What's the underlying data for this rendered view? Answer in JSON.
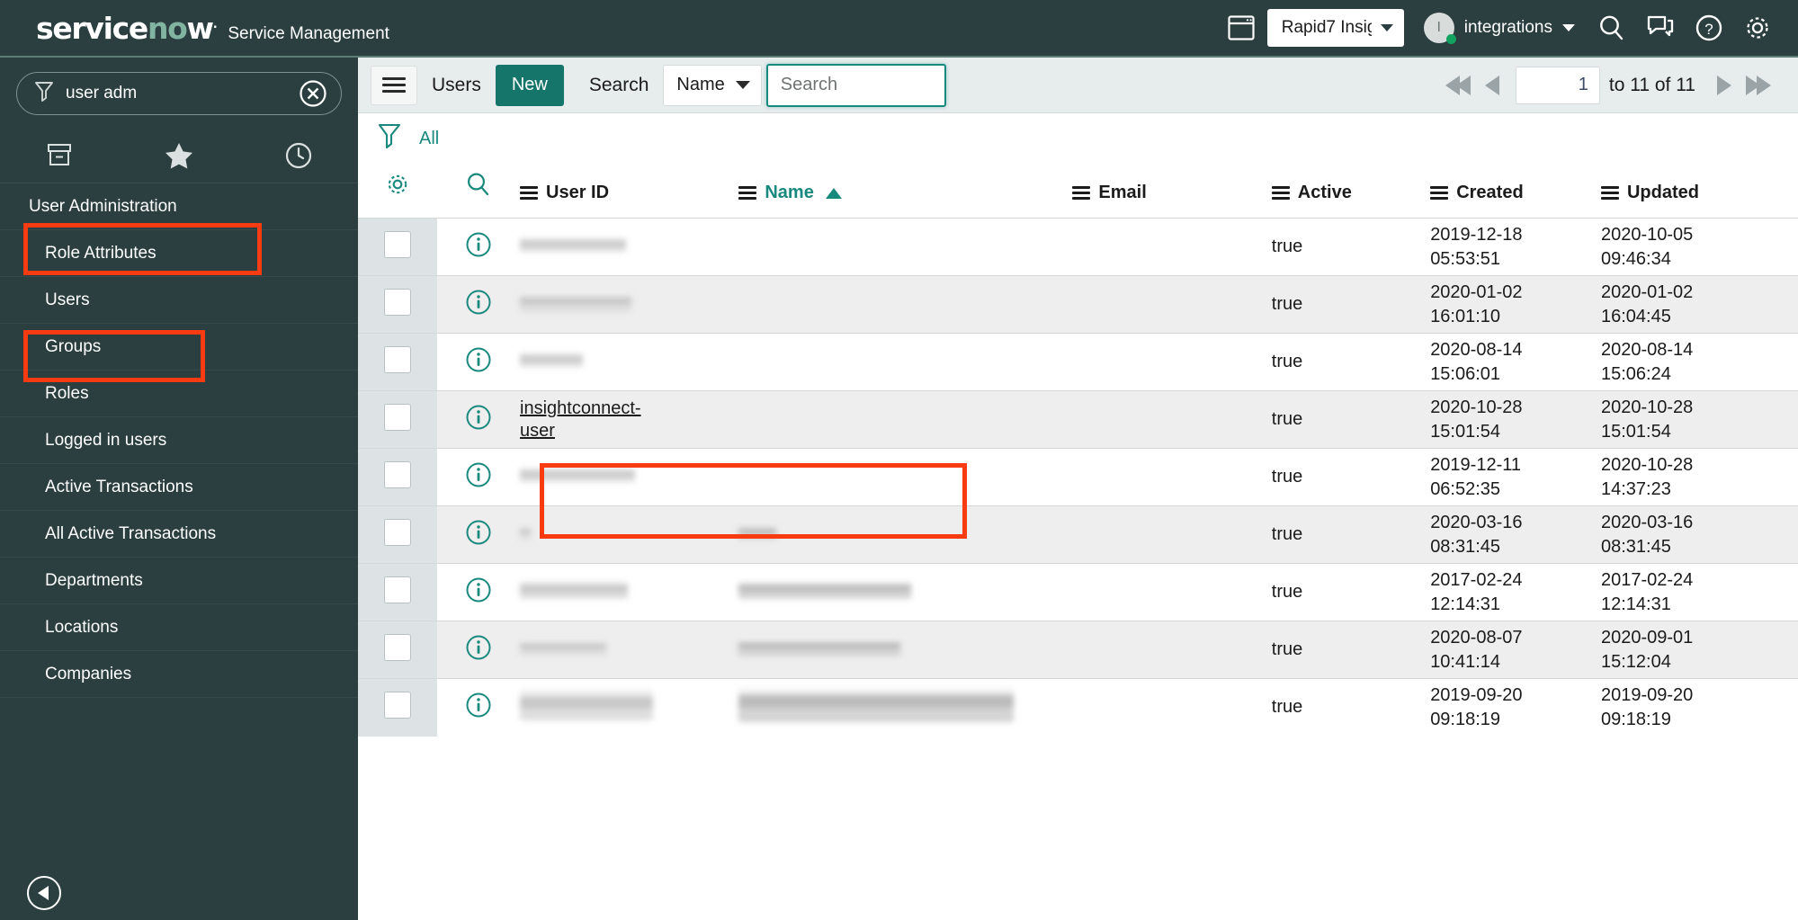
{
  "banner": {
    "logo_text": "servicenow",
    "logo_tm": ".",
    "product": "Service Management",
    "window_icon": "window-icon",
    "domain_picker": {
      "value": "Rapid7 Insig",
      "caret": "chevron-down-icon"
    },
    "user": {
      "initial": "I",
      "name": "integrations",
      "status": "online"
    },
    "icons": [
      "search-icon",
      "conversation-icon",
      "help-icon",
      "gear-icon"
    ]
  },
  "sidebar": {
    "filter": {
      "value": "user adm",
      "icon": "funnel-icon",
      "clear_icon": "clear-circle-icon"
    },
    "tabs": [
      {
        "name": "all-applications",
        "icon": "archive-box-icon"
      },
      {
        "name": "favorites",
        "icon": "star-icon"
      },
      {
        "name": "history",
        "icon": "clock-icon"
      }
    ],
    "items": [
      {
        "label": "User Administration",
        "type": "application",
        "highlighted": true
      },
      {
        "label": "Role Attributes",
        "type": "module",
        "highlighted": false
      },
      {
        "label": "Users",
        "type": "module",
        "highlighted": true
      },
      {
        "label": "Groups",
        "type": "module",
        "highlighted": false
      },
      {
        "label": "Roles",
        "type": "module",
        "highlighted": false
      },
      {
        "label": "Logged in users",
        "type": "module",
        "highlighted": false
      },
      {
        "label": "Active Transactions",
        "type": "module",
        "highlighted": false
      },
      {
        "label": "All Active Transactions",
        "type": "module",
        "highlighted": false
      },
      {
        "label": "Departments",
        "type": "module",
        "highlighted": false
      },
      {
        "label": "Locations",
        "type": "module",
        "highlighted": false
      },
      {
        "label": "Companies",
        "type": "module",
        "highlighted": false
      }
    ],
    "collapse_icon": "collapse-left-icon"
  },
  "toolbar": {
    "menu_icon": "hamburger-menu-icon",
    "title": "Users",
    "new_label": "New",
    "search_label": "Search",
    "search_field": "Name",
    "search_placeholder": "Search",
    "search_value": ""
  },
  "pagination": {
    "first_icon": "first-page-icon",
    "prev_icon": "previous-page-icon",
    "page_value": "1",
    "range_text": "to 11 of 11",
    "next_icon": "next-page-icon",
    "last_icon": "last-page-icon"
  },
  "breadcrumb": {
    "filter_icon": "funnel-icon",
    "label": "All"
  },
  "table": {
    "columns": [
      {
        "key": "gear",
        "label": "",
        "icon": "gear-icon"
      },
      {
        "key": "search",
        "label": "",
        "icon": "search-icon"
      },
      {
        "key": "user_id",
        "label": "User ID",
        "sorted": false
      },
      {
        "key": "name",
        "label": "Name",
        "sorted": true,
        "sort_dir": "asc"
      },
      {
        "key": "email",
        "label": "Email",
        "sorted": false
      },
      {
        "key": "active",
        "label": "Active",
        "sorted": false
      },
      {
        "key": "created",
        "label": "Created",
        "sorted": false
      },
      {
        "key": "updated",
        "label": "Updated",
        "sorted": false
      }
    ],
    "rows": [
      {
        "user_id": "",
        "user_id_redacted": true,
        "name": "",
        "name_redacted": false,
        "email": "",
        "active": "true",
        "created_date": "2019-12-18",
        "created_time": "05:53:51",
        "updated_date": "2020-10-05",
        "updated_time": "09:46:34",
        "highlighted": false
      },
      {
        "user_id": "",
        "user_id_redacted": true,
        "name": "",
        "name_redacted": false,
        "email": "",
        "active": "true",
        "created_date": "2020-01-02",
        "created_time": "16:01:10",
        "updated_date": "2020-01-02",
        "updated_time": "16:04:45",
        "highlighted": false
      },
      {
        "user_id": "",
        "user_id_redacted": true,
        "name": "",
        "name_redacted": false,
        "email": "",
        "active": "true",
        "created_date": "2020-08-14",
        "created_time": "15:06:01",
        "updated_date": "2020-08-14",
        "updated_time": "15:06:24",
        "highlighted": false
      },
      {
        "user_id": "insightconnect-user",
        "user_id_redacted": false,
        "name": "",
        "name_redacted": false,
        "email": "",
        "active": "true",
        "created_date": "2020-10-28",
        "created_time": "15:01:54",
        "updated_date": "2020-10-28",
        "updated_time": "15:01:54",
        "highlighted": true
      },
      {
        "user_id": "",
        "user_id_redacted": true,
        "name": "",
        "name_redacted": false,
        "email": "",
        "active": "true",
        "created_date": "2019-12-11",
        "created_time": "06:52:35",
        "updated_date": "2020-10-28",
        "updated_time": "14:37:23",
        "highlighted": false
      },
      {
        "user_id": "",
        "user_id_redacted": true,
        "name": "",
        "name_redacted": true,
        "email": "",
        "active": "true",
        "created_date": "2020-03-16",
        "created_time": "08:31:45",
        "updated_date": "2020-03-16",
        "updated_time": "08:31:45",
        "highlighted": false
      },
      {
        "user_id": "",
        "user_id_redacted": true,
        "name": "",
        "name_redacted": true,
        "email": "",
        "active": "true",
        "created_date": "2017-02-24",
        "created_time": "12:14:31",
        "updated_date": "2017-02-24",
        "updated_time": "12:14:31",
        "highlighted": false
      },
      {
        "user_id": "",
        "user_id_redacted": true,
        "name": "",
        "name_redacted": true,
        "email": "",
        "active": "true",
        "created_date": "2020-08-07",
        "created_time": "10:41:14",
        "updated_date": "2020-09-01",
        "updated_time": "15:12:04",
        "highlighted": false
      },
      {
        "user_id": "",
        "user_id_redacted": true,
        "name": "",
        "name_redacted": true,
        "email": "",
        "active": "true",
        "created_date": "2019-09-20",
        "created_time": "09:18:19",
        "updated_date": "2019-09-20",
        "updated_time": "09:18:19",
        "highlighted": false
      }
    ]
  },
  "annotations": {
    "color": "#f93b12",
    "boxes": [
      "user-administration-nav",
      "users-nav",
      "insightconnect-user-link"
    ]
  },
  "colors": {
    "banner_bg": "#2b3e40",
    "sidebar_bg": "#2b3e40",
    "accent_teal": "#19897d",
    "new_button": "#15756b",
    "annotation_red": "#f93b12",
    "row_alt": "#eeeeee",
    "checkbox_col": "#dde3e5"
  }
}
